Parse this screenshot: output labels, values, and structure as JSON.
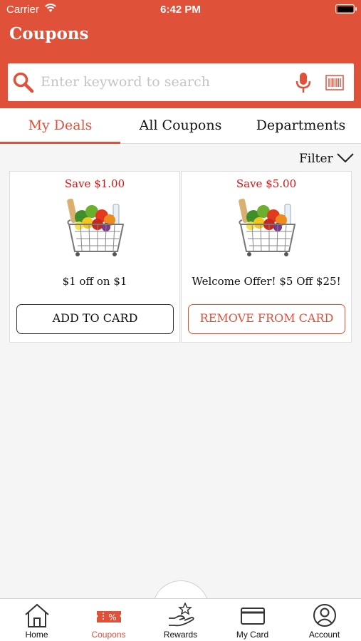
{
  "status_bar": {
    "carrier": "Carrier",
    "time": "6:42 PM"
  },
  "header": {
    "title": "Coupons"
  },
  "search": {
    "placeholder": "Enter keyword to search"
  },
  "tabs": [
    {
      "label": "My Deals",
      "active": true
    },
    {
      "label": "All Coupons",
      "active": false
    },
    {
      "label": "Departments",
      "active": false
    }
  ],
  "filter": {
    "label": "Filter"
  },
  "coupons": [
    {
      "save": "Save $1.00",
      "description": "$1 off on $1",
      "button": "ADD TO CARD",
      "image": "grocery-basket"
    },
    {
      "save": "Save $5.00",
      "description": "Welcome Offer! $5 Off $25!",
      "button": "REMOVE FROM CARD",
      "image": "grocery-basket"
    }
  ],
  "bottom_nav": [
    {
      "label": "Home",
      "icon": "home-icon"
    },
    {
      "label": "Coupons",
      "icon": "coupon-icon",
      "active": true
    },
    {
      "label": "Rewards",
      "icon": "rewards-icon"
    },
    {
      "label": "My Card",
      "icon": "card-icon"
    },
    {
      "label": "Account",
      "icon": "account-icon"
    }
  ],
  "colors": {
    "brand": "#e0513a",
    "save_text": "#e01010",
    "background": "#f5f5f5"
  }
}
